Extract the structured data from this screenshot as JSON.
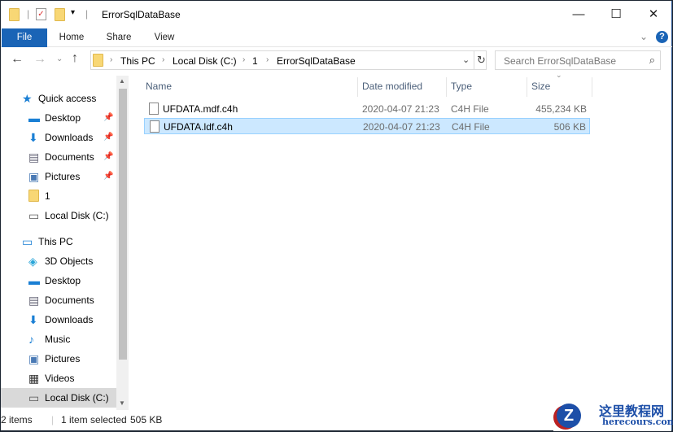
{
  "window": {
    "title": "ErrorSqlDataBase",
    "minimize": "—",
    "maximize": "☐",
    "close": "✕"
  },
  "ribbon": {
    "tabs": [
      "File",
      "Home",
      "Share",
      "View"
    ],
    "expand": "⌄",
    "help": "?"
  },
  "nav_buttons": {
    "back": "←",
    "forward": "→",
    "recent": "⌄",
    "up": "↑",
    "refresh": "↻"
  },
  "address": {
    "crumbs": [
      "This PC",
      "Local Disk (C:)",
      "1",
      "ErrorSqlDataBase"
    ],
    "separator": "›"
  },
  "search": {
    "placeholder": "Search ErrorSqlDataBase"
  },
  "nav_pane": {
    "items": [
      {
        "label": "Quick access",
        "icon": "star-icon",
        "level": 0
      },
      {
        "label": "Desktop",
        "icon": "desktop-icon",
        "level": 1,
        "pinned": true
      },
      {
        "label": "Downloads",
        "icon": "download-icon",
        "level": 1,
        "pinned": true
      },
      {
        "label": "Documents",
        "icon": "documents-icon",
        "level": 1,
        "pinned": true
      },
      {
        "label": "Pictures",
        "icon": "pictures-icon",
        "level": 1,
        "pinned": true
      },
      {
        "label": "1",
        "icon": "folder-icon",
        "level": 1
      },
      {
        "label": "Local Disk (C:)",
        "icon": "drive-icon",
        "level": 1
      },
      {
        "label": "This PC",
        "icon": "computer-icon",
        "level": 0
      },
      {
        "label": "3D Objects",
        "icon": "cube-icon",
        "level": 1
      },
      {
        "label": "Desktop",
        "icon": "desktop-icon",
        "level": 1
      },
      {
        "label": "Documents",
        "icon": "documents-icon",
        "level": 1
      },
      {
        "label": "Downloads",
        "icon": "download-icon",
        "level": 1
      },
      {
        "label": "Music",
        "icon": "music-icon",
        "level": 1
      },
      {
        "label": "Pictures",
        "icon": "pictures-icon",
        "level": 1
      },
      {
        "label": "Videos",
        "icon": "video-icon",
        "level": 1
      },
      {
        "label": "Local Disk (C:)",
        "icon": "drive-icon",
        "level": 1,
        "selected": true
      }
    ]
  },
  "columns": [
    "Name",
    "Date modified",
    "Type",
    "Size"
  ],
  "files": [
    {
      "name": "UFDATA.mdf.c4h",
      "date": "2020-04-07 21:23",
      "type": "C4H File",
      "size": "455,234 KB",
      "selected": false
    },
    {
      "name": "UFDATA.ldf.c4h",
      "date": "2020-04-07 21:23",
      "type": "C4H File",
      "size": "506 KB",
      "selected": true
    }
  ],
  "status": {
    "items": "2 items",
    "selected": "1 item selected",
    "size": "505 KB"
  },
  "watermark": {
    "title": "这里教程网",
    "url": "herecours.com"
  },
  "colors": {
    "accent": "#1a64b6",
    "selection": "#cce8ff"
  }
}
